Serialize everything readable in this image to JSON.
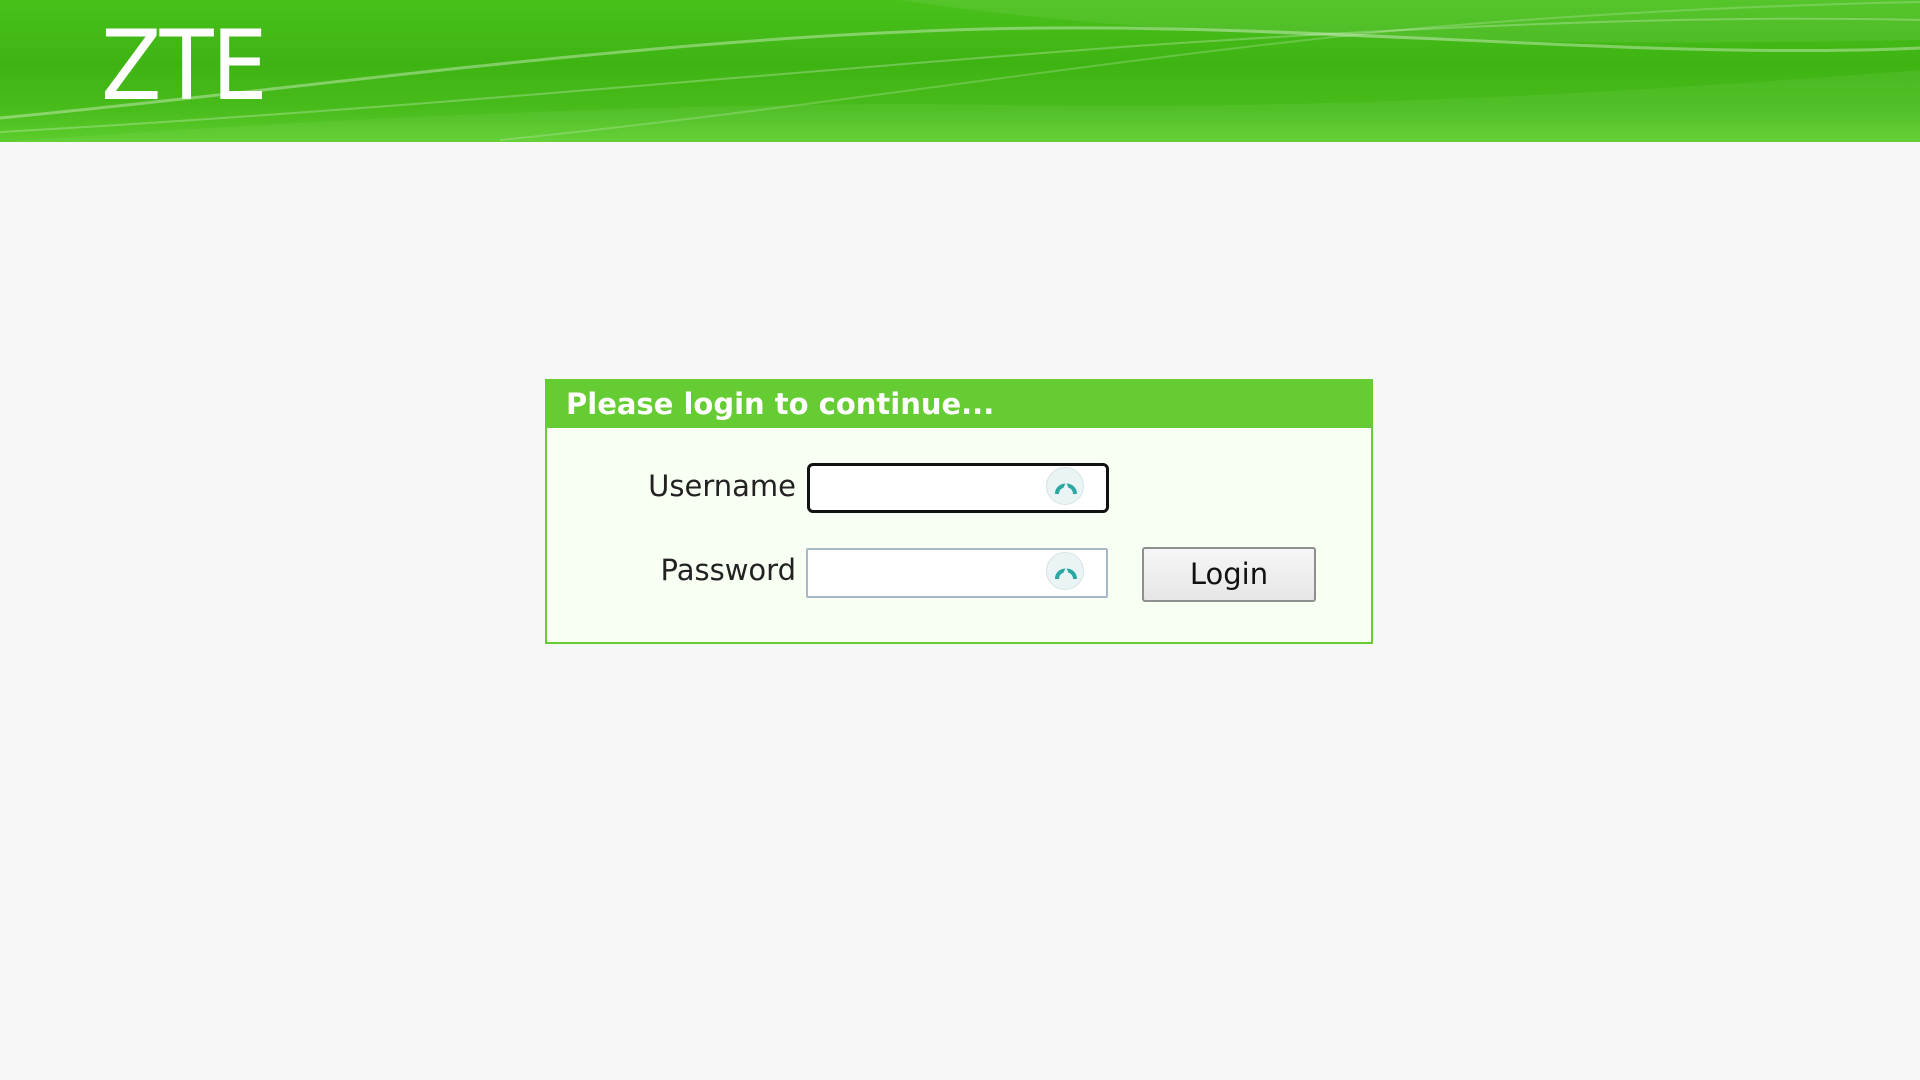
{
  "brand": {
    "logo_text": "ZTE",
    "header_color": "#3eb413"
  },
  "login": {
    "title": "Please login to continue...",
    "accent_color": "#66cc33",
    "username_label": "Username",
    "username_value": "",
    "password_label": "Password",
    "password_value": "",
    "login_button_label": "Login",
    "field_icon": "password-manager-key-icon"
  }
}
